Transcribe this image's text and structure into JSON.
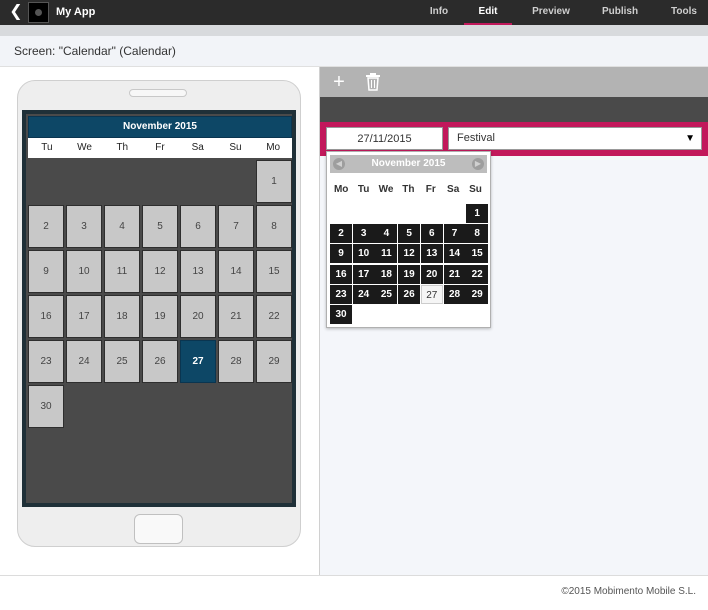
{
  "topbar": {
    "app_name": "My App",
    "back_icon": "chevron-left-icon",
    "tabs": [
      {
        "label": "Info",
        "active": false
      },
      {
        "label": "Edit",
        "active": true
      },
      {
        "label": "Preview",
        "active": false
      },
      {
        "label": "Publish",
        "active": false
      },
      {
        "label": "Tools",
        "active": false
      }
    ],
    "accent_color": "#c2185b"
  },
  "screen_bar": {
    "title": "Screen: \"Calendar\" (Calendar)"
  },
  "phone_calendar": {
    "month_label": "November 2015",
    "weekdays": [
      "Tu",
      "We",
      "Th",
      "Fr",
      "Sa",
      "Su",
      "Mo"
    ],
    "days": [
      1,
      2,
      3,
      4,
      5,
      6,
      7,
      8,
      9,
      10,
      11,
      12,
      13,
      14,
      15,
      16,
      17,
      18,
      19,
      20,
      21,
      22,
      23,
      24,
      25,
      26,
      27,
      28,
      29,
      30
    ],
    "selected_day": 27,
    "header_color": "#0d4766"
  },
  "editor": {
    "add_icon": "plus-icon",
    "delete_icon": "trash-icon",
    "date_value": "27/11/2015",
    "event_type": "Festival"
  },
  "datepicker": {
    "month_label": "November 2015",
    "weekdays": [
      "Mo",
      "Tu",
      "We",
      "Th",
      "Fr",
      "Sa",
      "Su"
    ],
    "days": [
      1,
      2,
      3,
      4,
      5,
      6,
      7,
      8,
      9,
      10,
      11,
      12,
      13,
      14,
      15,
      16,
      17,
      18,
      19,
      20,
      21,
      22,
      23,
      24,
      25,
      26,
      27,
      28,
      29,
      30
    ],
    "selected_day": 27,
    "prev_icon": "prev-arrow-icon",
    "next_icon": "next-arrow-icon"
  },
  "footer": {
    "copyright": "©2015 Mobimento Mobile S.L."
  }
}
